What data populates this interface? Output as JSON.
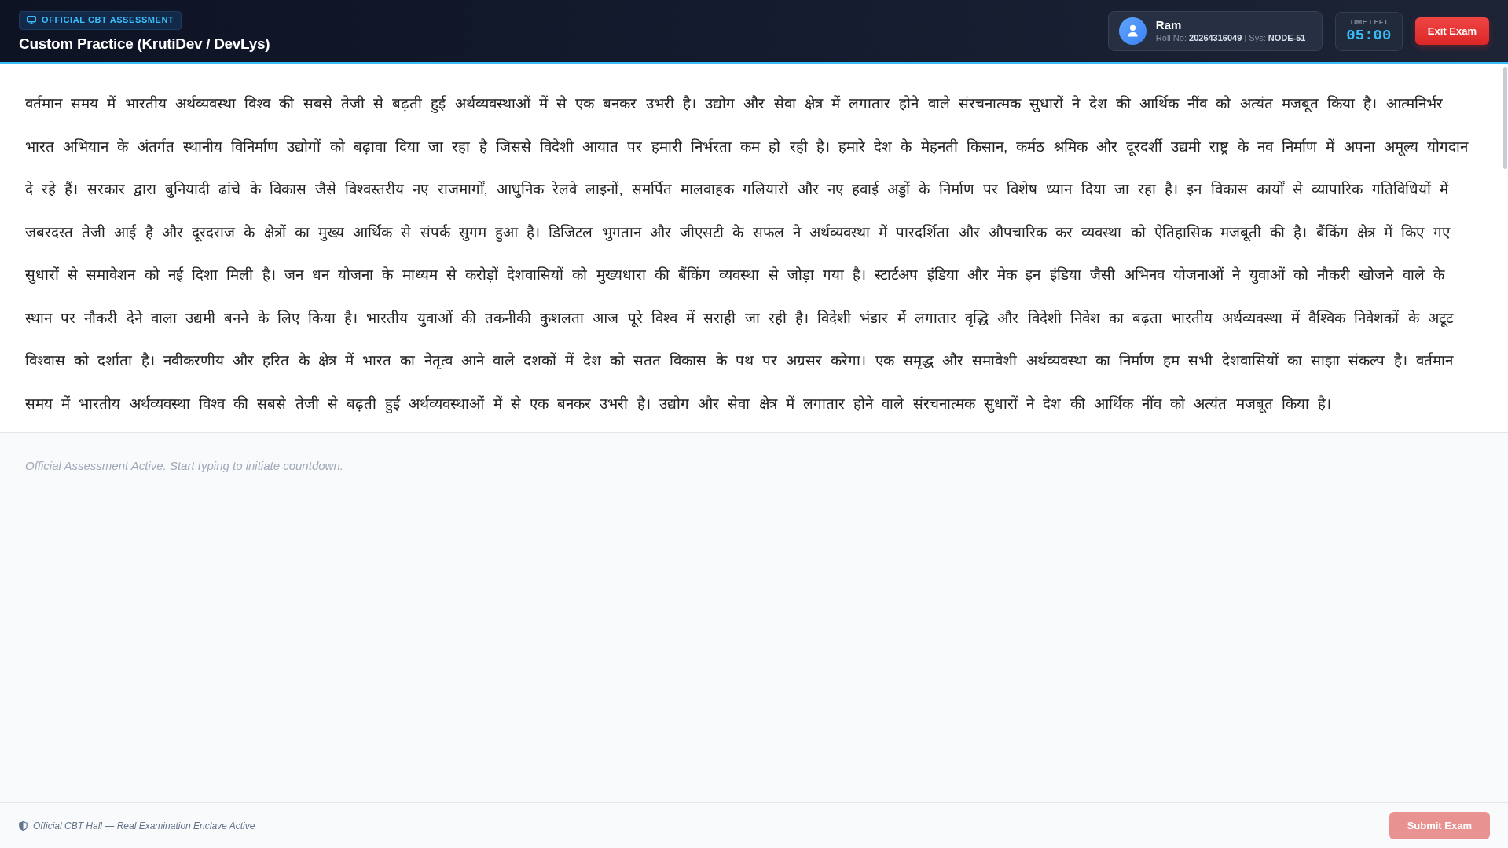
{
  "header": {
    "badge": "OFFICIAL CBT ASSESSMENT",
    "title": "Custom Practice (KrutiDev / DevLys)"
  },
  "candidate": {
    "name": "Ram",
    "details": "Roll No: **20264316049** | Sys: **NODE-51**"
  },
  "timer": {
    "label": "TIME LEFT",
    "value": "05:00"
  },
  "exit_button": {
    "label": "Exit Exam"
  },
  "passage": "वर्तमान समय में भारतीय अर्थव्यवस्था विश्व की सबसे तेजी से बढ़ती हुई अर्थव्यवस्थाओं में से एक बनकर उभरी है। उद्योग और सेवा क्षेत्र में लगातार होने वाले संरचनात्मक सुधारों ने देश की आर्थिक नींव को अत्यंत मजबूत किया है। आत्मनिर्भर भारत अभियान के अंतर्गत स्थानीय विनिर्माण उद्योगों को बढ़ावा दिया जा रहा है जिससे विदेशी आयात पर हमारी निर्भरता कम हो रही है। हमारे देश के मेहनती किसान, कर्मठ श्रमिक और दूरदर्शी उद्यमी राष्ट्र के नव निर्माण में अपना अमूल्य योगदान दे रहे हैं। सरकार द्वारा बुनियादी ढांचे के विकास जैसे विश्वस्तरीय नए राजमार्गों, आधुनिक रेलवे लाइनों, समर्पित मालवाहक गलियारों और नए हवाई अड्डों के निर्माण पर विशेष ध्यान दिया जा रहा है। इन विकास कार्यों से व्यापारिक गतिविधियों में जबरदस्त तेजी आई है और दूरदराज के क्षेत्रों का मुख्य आर्थिक से संपर्क सुगम हुआ है। डिजिटल भुगतान और जीएसटी के सफल ने अर्थव्यवस्था में पारदर्शिता और औपचारिक कर व्यवस्था को ऐतिहासिक मजबूती की है। बैंकिंग क्षेत्र में किए गए सुधारों से समावेशन को नई दिशा मिली है। जन धन योजना के माध्यम से करोड़ों देशवासियों को मुख्यधारा की बैंकिंग व्यवस्था से जोड़ा गया है। स्टार्टअप इंडिया और मेक इन इंडिया जैसी अभिनव योजनाओं ने युवाओं को नौकरी खोजने वाले के स्थान पर नौकरी देने वाला उद्यमी बनने के लिए किया है। भारतीय युवाओं की तकनीकी कुशलता आज पूरे विश्व में सराही जा रही है। विदेशी भंडार में लगातार वृद्धि और विदेशी निवेश का बढ़ता भारतीय अर्थव्यवस्था में वैश्विक निवेशकों के अटूट विश्वास को दर्शाता है। नवीकरणीय और हरित के क्षेत्र में भारत का नेतृत्व आने वाले दशकों में देश को सतत विकास के पथ पर अग्रसर करेगा। एक समृद्ध और समावेशी अर्थव्यवस्था का निर्माण हम सभी देशवासियों का साझा संकल्प है। वर्तमान समय में भारतीय अर्थव्यवस्था विश्व की सबसे तेजी से बढ़ती हुई अर्थव्यवस्थाओं में से एक बनकर उभरी है। उद्योग और सेवा क्षेत्र में लगातार होने वाले संरचनात्मक सुधारों ने देश की आर्थिक नींव को अत्यंत मजबूत किया है।",
  "answer": {
    "placeholder": "Official Assessment Active. Start typing to initiate countdown."
  },
  "footer": {
    "status": "Official CBT Hall — Real Examination Enclave Active",
    "submit_button": {
      "label": "Submit Exam",
      "disabled": true
    }
  }
}
